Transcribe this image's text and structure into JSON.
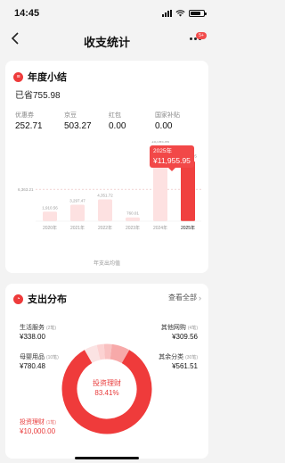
{
  "status_bar": {
    "time": "14:45"
  },
  "nav": {
    "title": "收支统计",
    "badge": "5+"
  },
  "annual": {
    "title": "年度小结",
    "saved": "已省755.98",
    "stats": [
      {
        "label": "优惠券",
        "value": "252.71"
      },
      {
        "label": "京豆",
        "value": "503.27"
      },
      {
        "label": "红包",
        "value": "0.00"
      },
      {
        "label": "国家补贴",
        "value": "0.00"
      }
    ],
    "tooltip": {
      "year": "2025年",
      "amount": "¥11,955.95"
    },
    "chart_note": "年支出均值"
  },
  "chart_data": {
    "type": "bar",
    "categories": [
      "2020年",
      "2021年",
      "2022年",
      "2023年",
      "2024年",
      "2025年"
    ],
    "values": [
      1910.56,
      3297.47,
      4351.72,
      760.01,
      15094.96,
      11955.95
    ],
    "value_labels": [
      "1,910.56",
      "3,297.47",
      "4,351.72",
      "760.01",
      "15,094.96",
      "11,955.95"
    ],
    "average": 6363.21,
    "average_label": "6,363.21",
    "ylim": [
      0,
      16000
    ],
    "highlight_index": 5,
    "colors": {
      "bar": "#fde1e1",
      "highlight": "#f0403f",
      "avg_line": "#e9b9b9"
    }
  },
  "spending": {
    "title": "支出分布",
    "view_all": "查看全部",
    "center": {
      "name": "投资理财",
      "percent": "83.41%"
    },
    "legend": [
      {
        "name": "生活服务",
        "count": "(2笔)",
        "amount": "¥338.00"
      },
      {
        "name": "其他网购",
        "count": "(4笔)",
        "amount": "¥309.56"
      },
      {
        "name": "母婴用品",
        "count": "(10笔)",
        "amount": "¥780.48"
      },
      {
        "name": "其余分类",
        "count": "(30笔)",
        "amount": "¥561.51"
      },
      {
        "name": "投资理财",
        "count": "(1笔)",
        "amount": "¥10,000.00"
      }
    ],
    "donut": [
      {
        "name": "投资理财",
        "value": 10000.0,
        "color": "#ef3b3b"
      },
      {
        "name": "其余分类",
        "value": 561.51,
        "color": "#fbe3e3"
      },
      {
        "name": "其他网购",
        "value": 309.56,
        "color": "#fcd2d2"
      },
      {
        "name": "生活服务",
        "value": 338.0,
        "color": "#f9c1c1"
      },
      {
        "name": "母婴用品",
        "value": 780.48,
        "color": "#f7a9a9"
      }
    ]
  }
}
